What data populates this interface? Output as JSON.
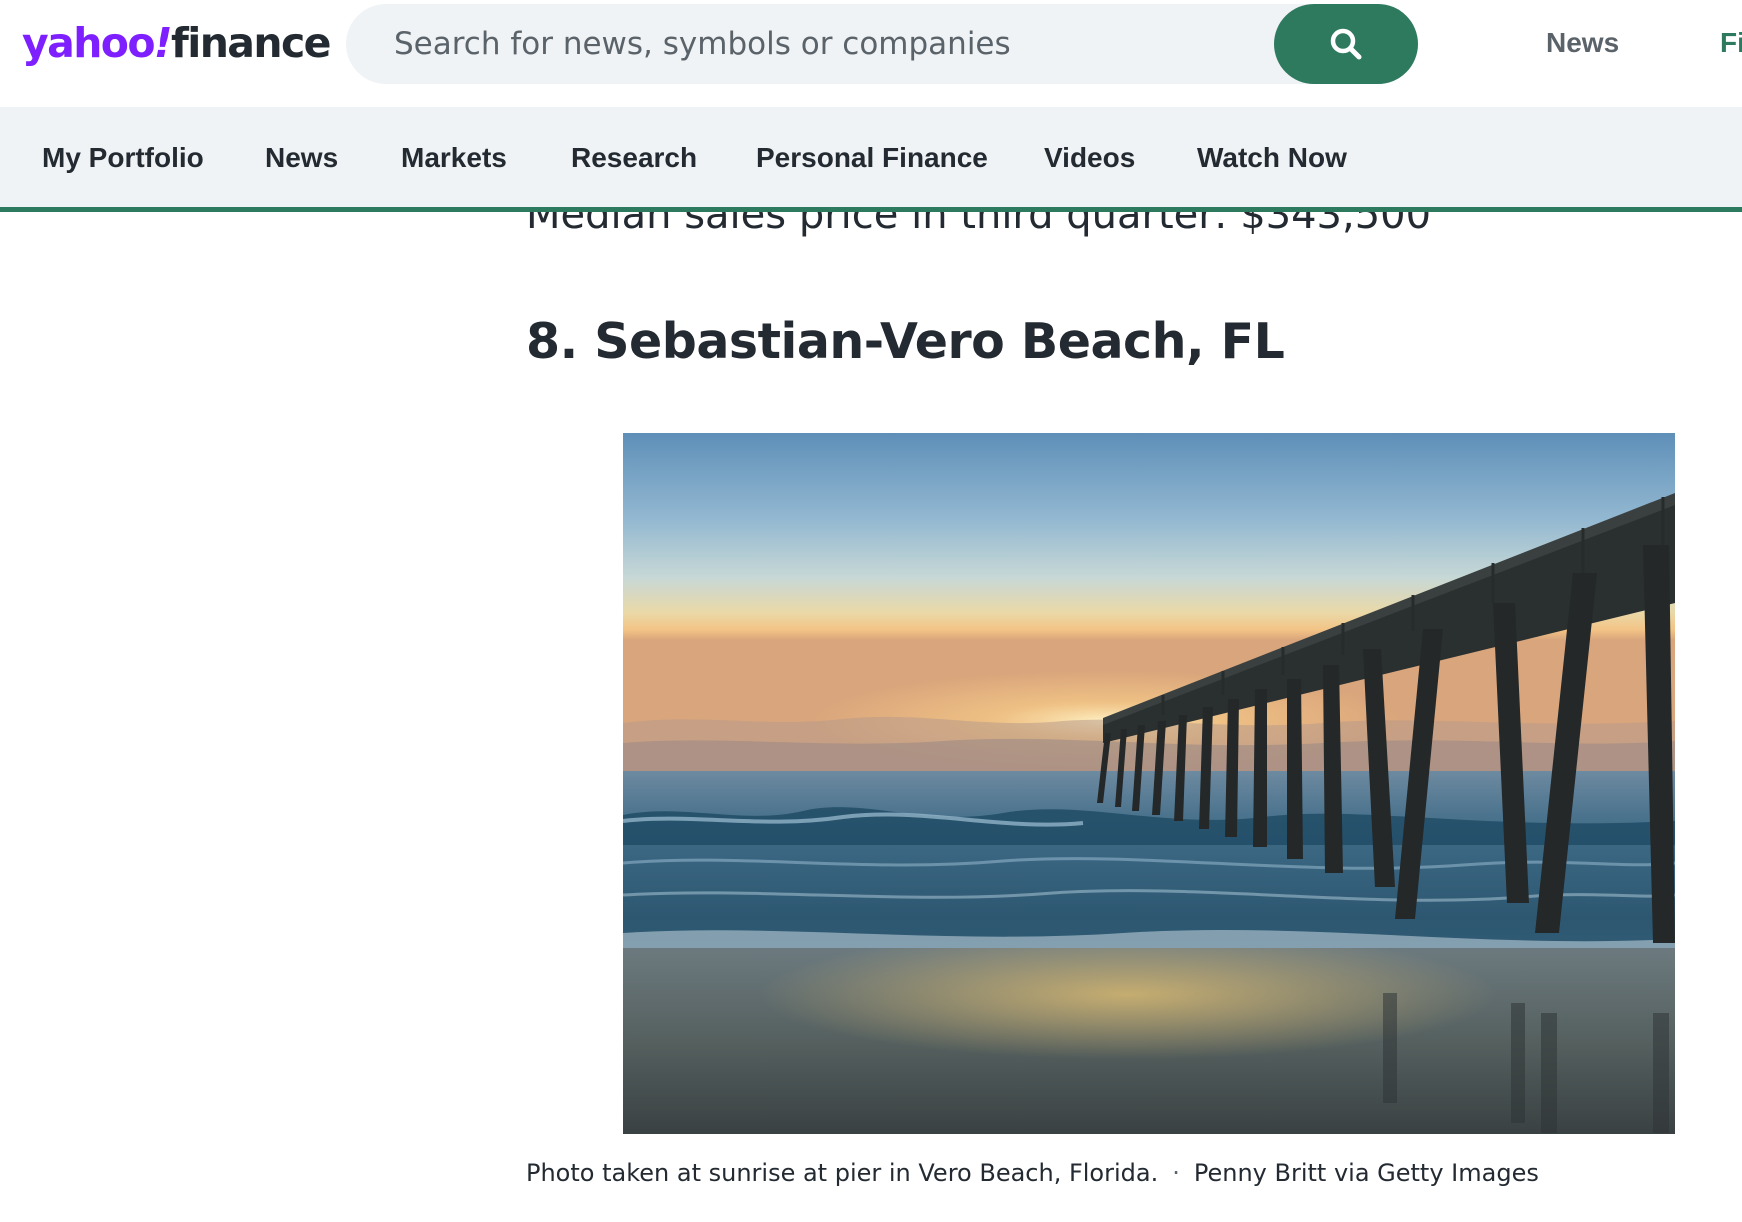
{
  "header": {
    "logo": {
      "yahoo": "yahoo",
      "bang": "!",
      "finance": "finance"
    },
    "search": {
      "placeholder": "Search for news, symbols or companies",
      "button_icon": "search-icon"
    },
    "top_links": [
      "News",
      "Fi"
    ]
  },
  "nav": {
    "items": [
      "My Portfolio",
      "News",
      "Markets",
      "Research",
      "Personal Finance",
      "Videos",
      "Watch Now"
    ]
  },
  "article": {
    "cut_text": "Median sales price in third quarter: $343,500",
    "heading": "8. Sebastian-Vero Beach, FL",
    "caption": "Photo taken at sunrise at pier in Vero Beach, Florida.",
    "credit_separator": "·",
    "credit": "Penny Britt via Getty Images"
  },
  "colors": {
    "brand_purple": "#7e1fff",
    "accent_green": "#2e7a5e",
    "text_dark": "#232a31",
    "text_muted": "#5b636a",
    "nav_bg": "#f0f3f5"
  }
}
